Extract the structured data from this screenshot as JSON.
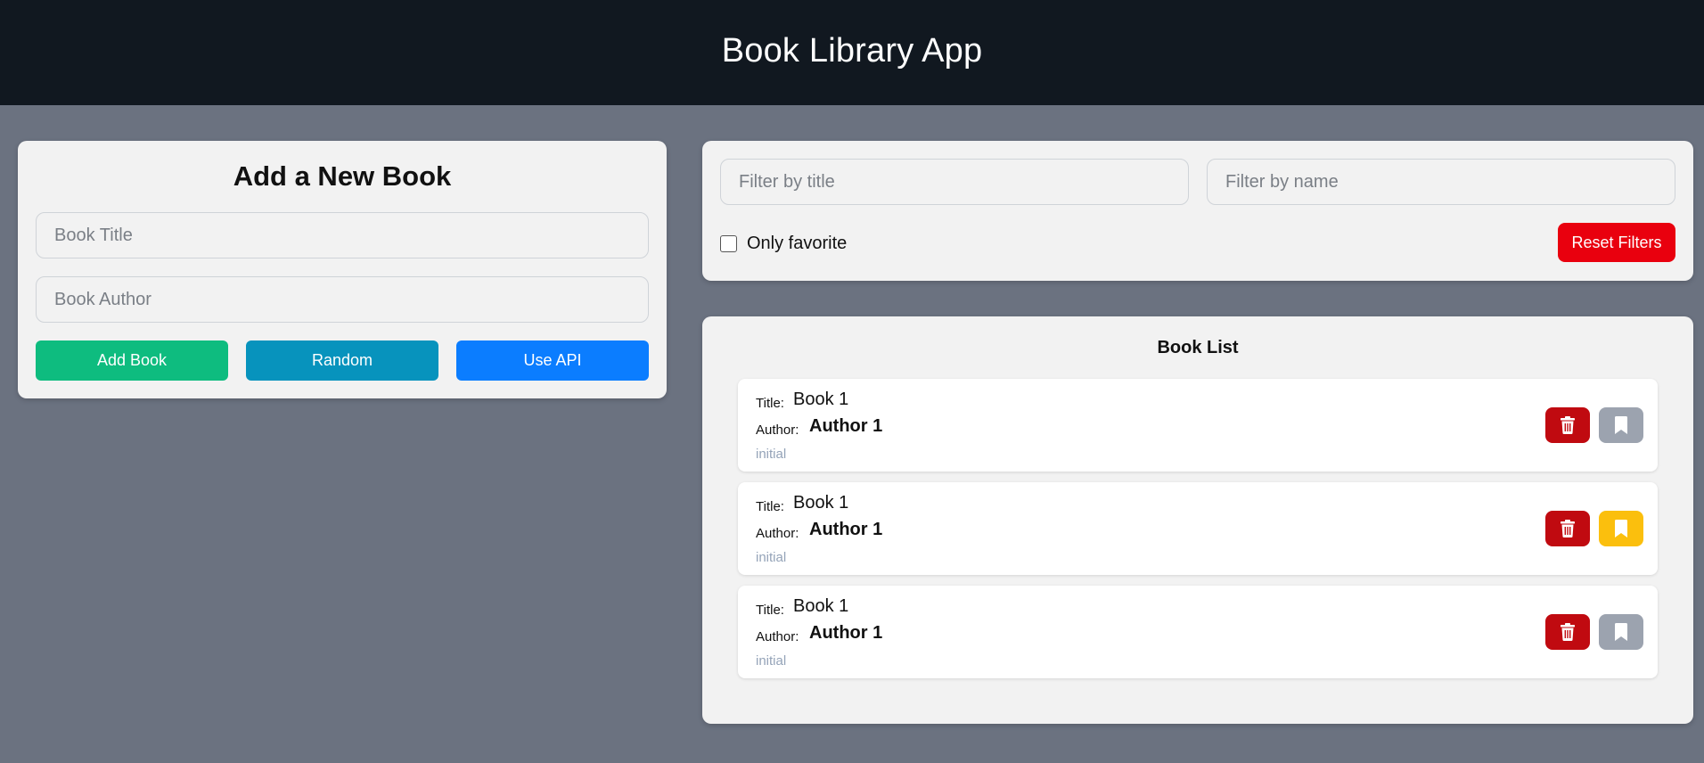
{
  "header": {
    "title": "Book Library App"
  },
  "add_form": {
    "heading": "Add a New Book",
    "title_placeholder": "Book Title",
    "author_placeholder": "Book Author",
    "add_label": "Add Book",
    "random_label": "Random",
    "api_label": "Use API"
  },
  "filters": {
    "title_placeholder": "Filter by title",
    "name_placeholder": "Filter by name",
    "only_favorite_label": "Only favorite",
    "only_favorite_checked": false,
    "reset_label": "Reset Filters"
  },
  "book_list": {
    "heading": "Book List",
    "title_label": "Title:",
    "author_label": "Author:",
    "books": [
      {
        "title": "Book 1",
        "author": "Author 1",
        "source": "initial",
        "favorite": false
      },
      {
        "title": "Book 1",
        "author": "Author 1",
        "source": "initial",
        "favorite": true
      },
      {
        "title": "Book 1",
        "author": "Author 1",
        "source": "initial",
        "favorite": false
      }
    ]
  },
  "colors": {
    "header_bg": "#111820",
    "page_bg": "#6b7280",
    "add_button": "#0ebc7f",
    "random_button": "#0793bd",
    "api_button": "#0b7dff",
    "reset_button": "#e9000e",
    "delete_button": "#c00a10",
    "favorite_on": "#fbbf0d",
    "favorite_off": "#9ca3af"
  },
  "icons": {
    "delete": "trash-icon",
    "favorite": "bookmark-icon"
  }
}
